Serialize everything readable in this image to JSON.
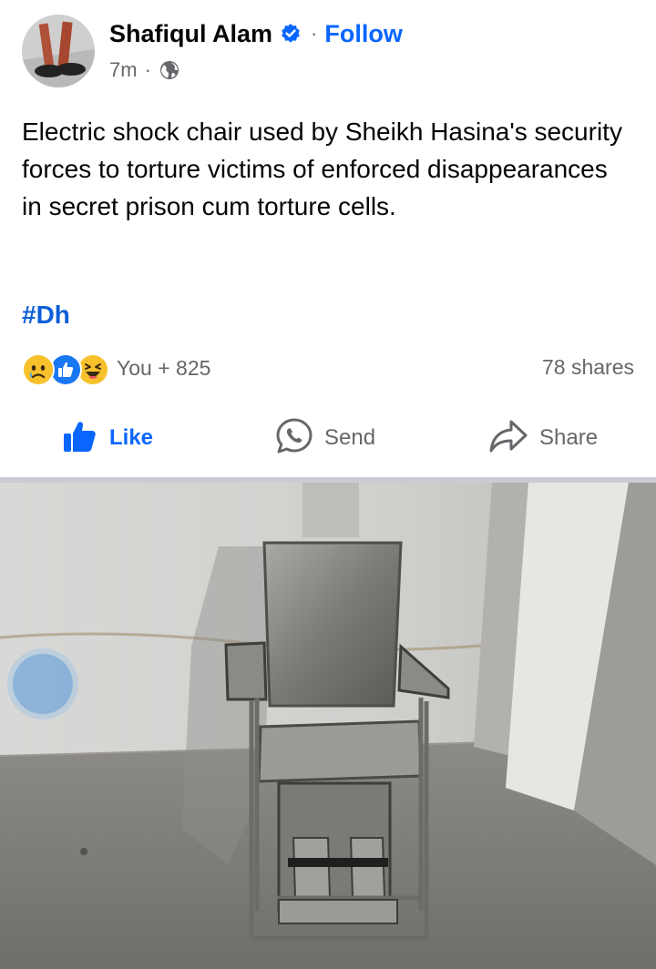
{
  "post": {
    "author": "Shafiqul Alam",
    "separator": "·",
    "follow_label": "Follow",
    "time": "7m",
    "meta_dot": "·",
    "text": "Electric shock chair used by Sheikh Hasina's security forces to torture victims of enforced disappearances in secret prison cum torture cells.",
    "hashtag": "#Dh"
  },
  "engagement": {
    "reaction_icons": [
      "sad-emoji-icon",
      "like-reaction-icon",
      "haha-emoji-icon"
    ],
    "reaction_count": "You + 825",
    "shares": "78 shares"
  },
  "actions": {
    "like": "Like",
    "send": "Send",
    "share": "Share"
  },
  "colors": {
    "accent": "#0866ff",
    "hashtag": "#0b5ed7",
    "secondary_text": "#65676b"
  }
}
